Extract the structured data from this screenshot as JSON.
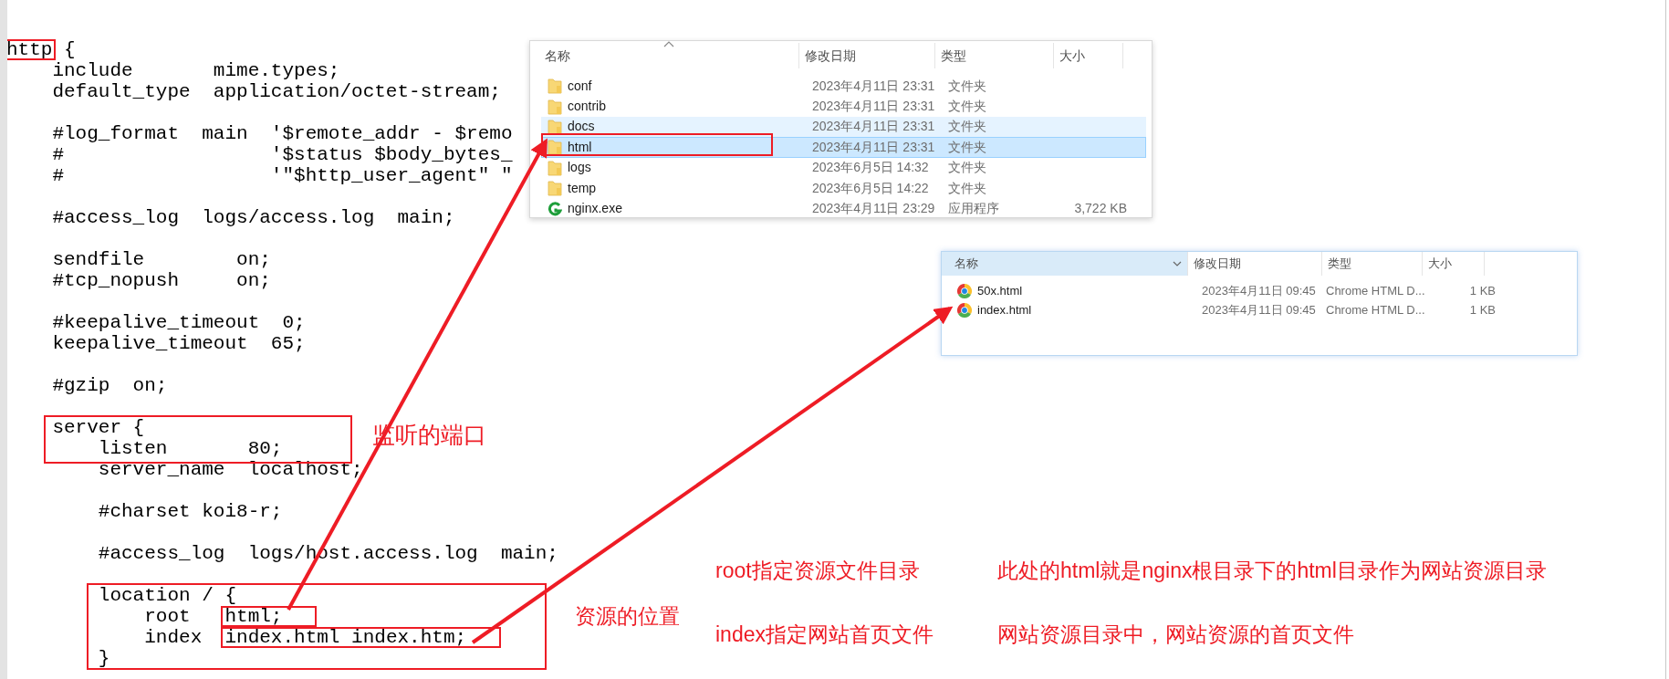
{
  "editor": {
    "blocks": [
      [
        {
          "parts": [
            {
              "text": "http",
              "boxed": true
            },
            {
              "text": " {",
              "boxed": false
            }
          ]
        },
        {
          "text": "    include       mime.types;"
        },
        {
          "text": "    default_type  application/octet-stream;"
        }
      ],
      [
        {
          "text": "    #log_format  main  '$remote_addr - $remo"
        },
        {
          "text": "    #                  '$status $body_bytes_"
        },
        {
          "text": "    #                  '\"$http_user_agent\" \""
        }
      ],
      [
        {
          "text": "    #access_log  logs/access.log  main;"
        }
      ],
      [
        {
          "text": "    sendfile        on;"
        },
        {
          "text": "    #tcp_nopush     on;"
        }
      ],
      [
        {
          "text": "    #keepalive_timeout  0;"
        },
        {
          "text": "    keepalive_timeout  65;"
        }
      ],
      [
        {
          "text": "    #gzip  on;"
        }
      ],
      [
        {
          "text": "    server {"
        },
        {
          "text": "        listen       80;"
        },
        {
          "text": "        server_name  localhost;"
        }
      ],
      [
        {
          "text": "        #charset koi8-r;"
        }
      ],
      [
        {
          "text": "        #access_log  logs/host.access.log  main;"
        }
      ],
      [
        {
          "text": "        location / {"
        },
        {
          "parts": [
            {
              "text": "            root   ",
              "boxed": false
            },
            {
              "text": "html;",
              "boxed": true
            }
          ]
        },
        {
          "parts": [
            {
              "text": "            index  ",
              "boxed": false
            },
            {
              "text": "index.html index.htm;",
              "boxed": true
            }
          ]
        },
        {
          "text": "        }"
        }
      ]
    ]
  },
  "explorer_top": {
    "columns": [
      "名称",
      "修改日期",
      "类型",
      "大小"
    ],
    "rows": [
      {
        "kind": "folder",
        "name": "conf",
        "modified": "2023年4月11日 23:31",
        "type": "文件夹",
        "selected": false,
        "hovered": false
      },
      {
        "kind": "folder",
        "name": "contrib",
        "modified": "2023年4月11日 23:31",
        "type": "文件夹",
        "selected": false,
        "hovered": false
      },
      {
        "kind": "folder",
        "name": "docs",
        "modified": "2023年4月11日 23:31",
        "type": "文件夹",
        "selected": false,
        "hovered": true
      },
      {
        "kind": "folder",
        "name": "html",
        "modified": "2023年4月11日 23:31",
        "type": "文件夹",
        "selected": true,
        "hovered": false
      },
      {
        "kind": "folder",
        "name": "logs",
        "modified": "2023年6月5日 14:32",
        "type": "文件夹",
        "selected": false,
        "hovered": false
      },
      {
        "kind": "folder",
        "name": "temp",
        "modified": "2023年6月5日 14:22",
        "type": "文件夹",
        "selected": false,
        "hovered": false
      },
      {
        "kind": "app",
        "name": "nginx.exe",
        "modified": "2023年4月11日 23:29",
        "type": "应用程序",
        "size": "3,722 KB",
        "selected": false,
        "hovered": false
      }
    ]
  },
  "explorer_bottom": {
    "columns": [
      "名称",
      "修改日期",
      "类型",
      "大小"
    ],
    "rows": [
      {
        "kind": "browser",
        "name": "50x.html",
        "modified": "2023年4月11日 09:45",
        "type": "Chrome HTML D...",
        "size": "1 KB"
      },
      {
        "kind": "browser",
        "name": "index.html",
        "modified": "2023年4月11日 09:45",
        "type": "Chrome HTML D...",
        "size": "1 KB"
      }
    ]
  },
  "annotations": [
    "监听的端口",
    "资源的位置",
    "root指定资源文件目录",
    "此处的html就是nginx根目录下的html目录作为网站资源目录",
    "index指定网站首页文件",
    "网站资源目录中，网站资源的首页文件"
  ]
}
